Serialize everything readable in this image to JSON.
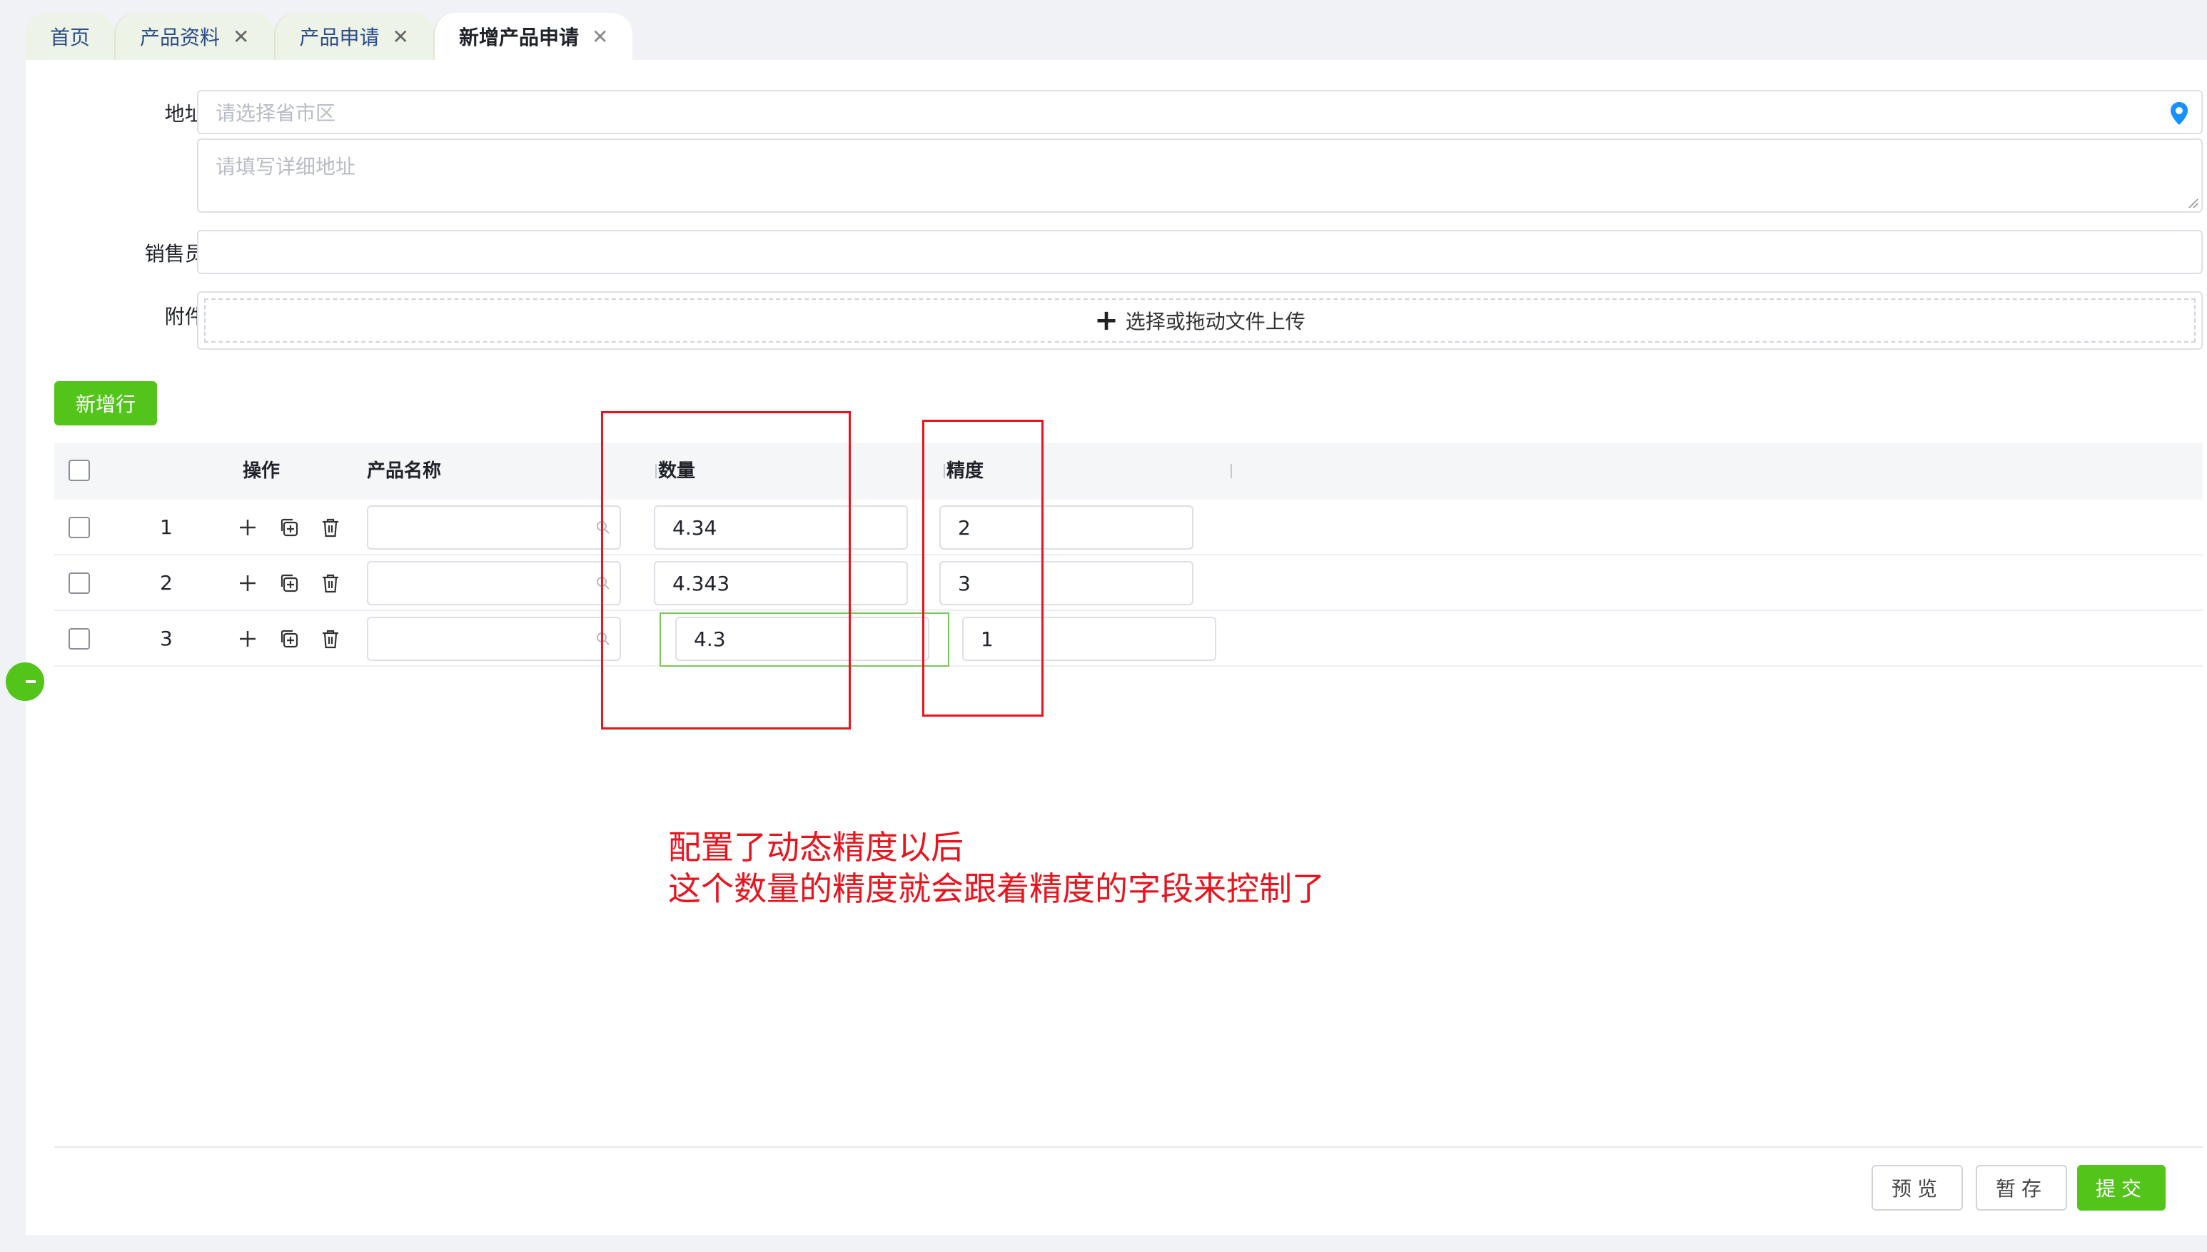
{
  "tabs": [
    {
      "label": "首页",
      "closable": false
    },
    {
      "label": "产品资料",
      "closable": true
    },
    {
      "label": "产品申请",
      "closable": true
    },
    {
      "label": "新增产品申请",
      "closable": true,
      "active": true
    }
  ],
  "form": {
    "address_label": "地址:",
    "address_region_placeholder": "请选择省市区",
    "address_detail_placeholder": "请填写详细地址",
    "salesperson_label": "销售员:",
    "salesperson_value": "",
    "attachment_label": "附件:",
    "upload_text": "选择或拖动文件上传"
  },
  "toolbar": {
    "add_row_label": "新增行"
  },
  "table": {
    "headers": {
      "operation": "操作",
      "product_name": "产品名称",
      "quantity": "数量",
      "precision": "精度"
    },
    "rows": [
      {
        "index": "1",
        "product_name": "",
        "quantity": "4.34",
        "precision": "2"
      },
      {
        "index": "2",
        "product_name": "",
        "quantity": "4.343",
        "precision": "3"
      },
      {
        "index": "3",
        "product_name": "",
        "quantity": "4.3",
        "precision": "1"
      }
    ]
  },
  "annotation": {
    "line1": "配置了动态精度以后",
    "line2": "这个数量的精度就会跟着精度的字段来控制了"
  },
  "footer": {
    "preview_label": "预览",
    "save_draft_label": "暂存",
    "submit_label": "提交"
  },
  "colors": {
    "accent": "#52c41a",
    "annotation": "#e8141e",
    "tab_text": "#2d4d8a"
  }
}
